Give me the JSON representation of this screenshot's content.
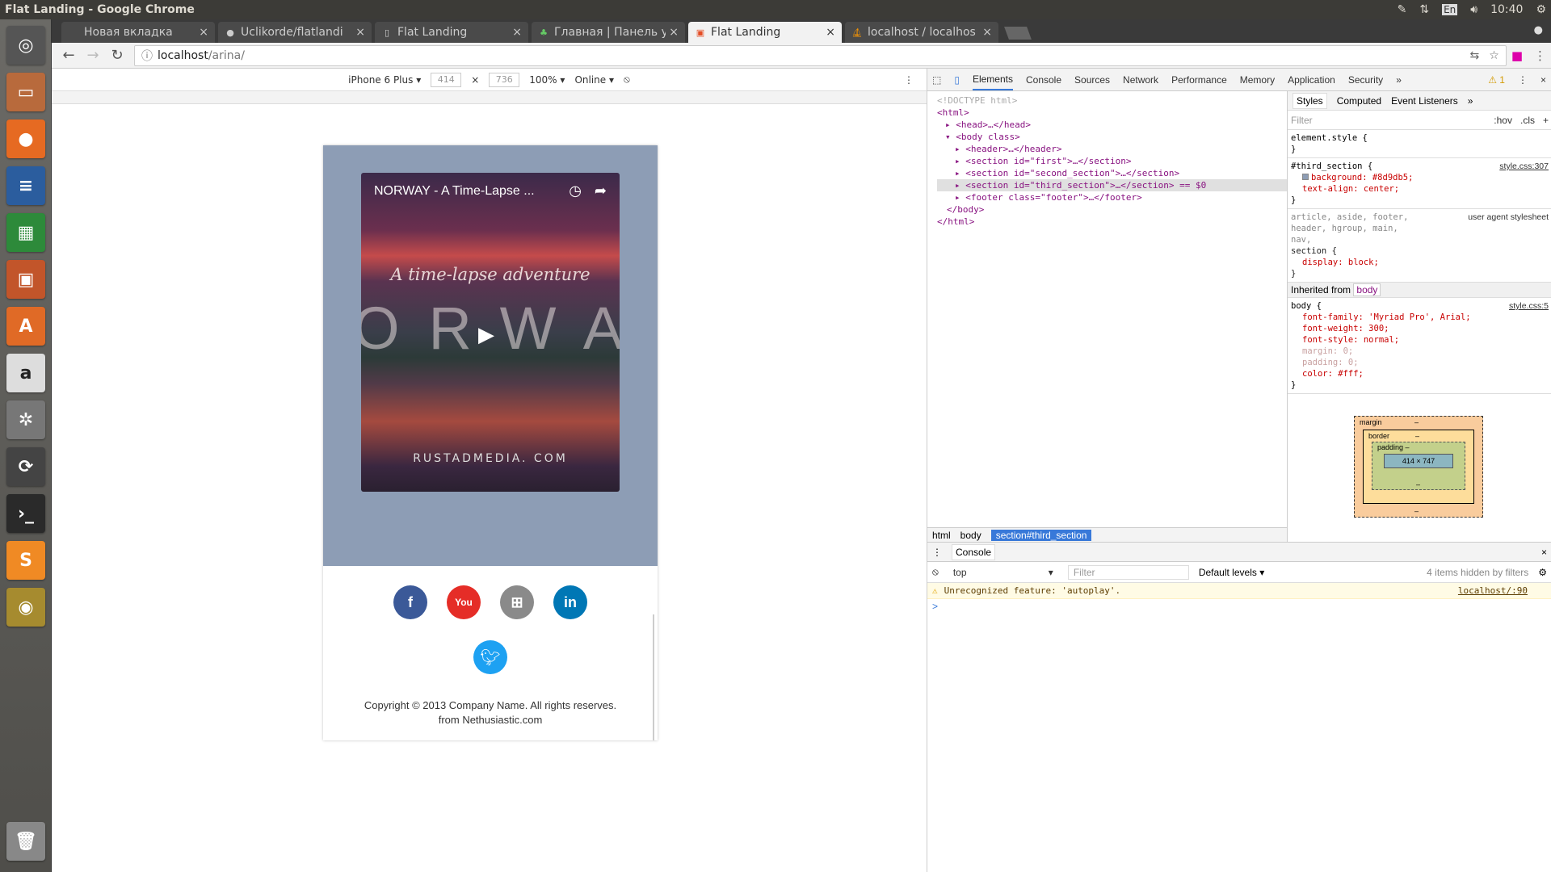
{
  "os": {
    "window_title": "Flat Landing - Google Chrome",
    "keyboard": "En",
    "clock": "10:40"
  },
  "launcher": {
    "items": [
      "dash",
      "files",
      "firefox",
      "writer",
      "calc",
      "impress",
      "software-center",
      "amazon",
      "settings",
      "updater",
      "terminal",
      "sublime",
      "chrome"
    ],
    "trash": "trash"
  },
  "tabs": [
    {
      "label": "Новая вкладка",
      "icon": "blank-icon"
    },
    {
      "label": "Uclikorde/flatlandi",
      "icon": "github-icon"
    },
    {
      "label": "Flat Landing",
      "icon": "page-icon"
    },
    {
      "label": "Главная | Панель уп",
      "icon": "leaf-icon"
    },
    {
      "label": "Flat Landing",
      "icon": "html-icon",
      "active": true
    },
    {
      "label": "localhost / localhos",
      "icon": "pma-icon"
    }
  ],
  "address": {
    "host": "localhost",
    "path": "/arina/"
  },
  "device_bar": {
    "device": "iPhone 6 Plus",
    "width": "414",
    "height": "736",
    "zoom": "100%",
    "network": "Online"
  },
  "page": {
    "video_title": "NORWAY - A Time-Lapse ...",
    "tagline": "A time-lapse adventure",
    "big_text": "ORWA",
    "watermark": "RUSTADMEDIA. COM",
    "copyright_line1": "Copyright © 2013 Company Name. All rights reserves.",
    "copyright_line2": "from Nethusiastic.com",
    "colors": {
      "section_bg": "#8d9db5",
      "facebook": "#3b5998",
      "youtube": "#e52d27",
      "flickr": "#8a8a8a",
      "linkedin": "#0077b5",
      "twitter": "#1da1f2"
    }
  },
  "devtools": {
    "tabs": [
      "Elements",
      "Console",
      "Sources",
      "Network",
      "Performance",
      "Memory",
      "Application",
      "Security"
    ],
    "warnings": "1",
    "dom": [
      "<!DOCTYPE html>",
      "<html>",
      "<head>…</head>",
      "<body class>",
      "<header>…</header>",
      "<section id=\"first\">…</section>",
      "<section id=\"second_section\">…</section>",
      "<section id=\"third_section\">…</section> == $0",
      "<footer class=\"footer\">…</footer>",
      "</body>",
      "</html>"
    ],
    "crumbs": [
      "html",
      "body",
      "section#third_section"
    ],
    "styles_tabs": [
      "Styles",
      "Computed",
      "Event Listeners"
    ],
    "filter_placeholder": "Filter",
    "hov": ":hov",
    "cls": ".cls",
    "rule_element": "element.style {",
    "rule_third_selector": "#third_section {",
    "rule_third_src": "style.css:307",
    "rule_third_bg": "background: #8d9db5;",
    "rule_third_align": "text-align: center;",
    "ua_selectors": "article, aside, footer, header, hgroup, main, nav,",
    "ua_label": "user agent stylesheet",
    "ua_section": "section {",
    "ua_display": "display: block;",
    "inherited_label": "Inherited from",
    "inherited_tag": "body",
    "body_selector": "body {",
    "body_src": "style.css:5",
    "body_props": [
      "font-family: 'Myriad Pro', Arial;",
      "font-weight: 300;",
      "font-style: normal;",
      "margin: 0;",
      "padding: 0;",
      "color: #fff;"
    ],
    "box": {
      "margin": "margin",
      "border": "border",
      "padding": "padding –",
      "content": "414 × 747",
      "dash": "–"
    },
    "console": {
      "title": "Console",
      "context": "top",
      "filter_placeholder": "Filter",
      "levels": "Default levels",
      "hidden": "4 items hidden by filters",
      "warning_text": "Unrecognized feature: 'autoplay'.",
      "warning_src": "localhost/:90",
      "prompt": ">"
    }
  }
}
